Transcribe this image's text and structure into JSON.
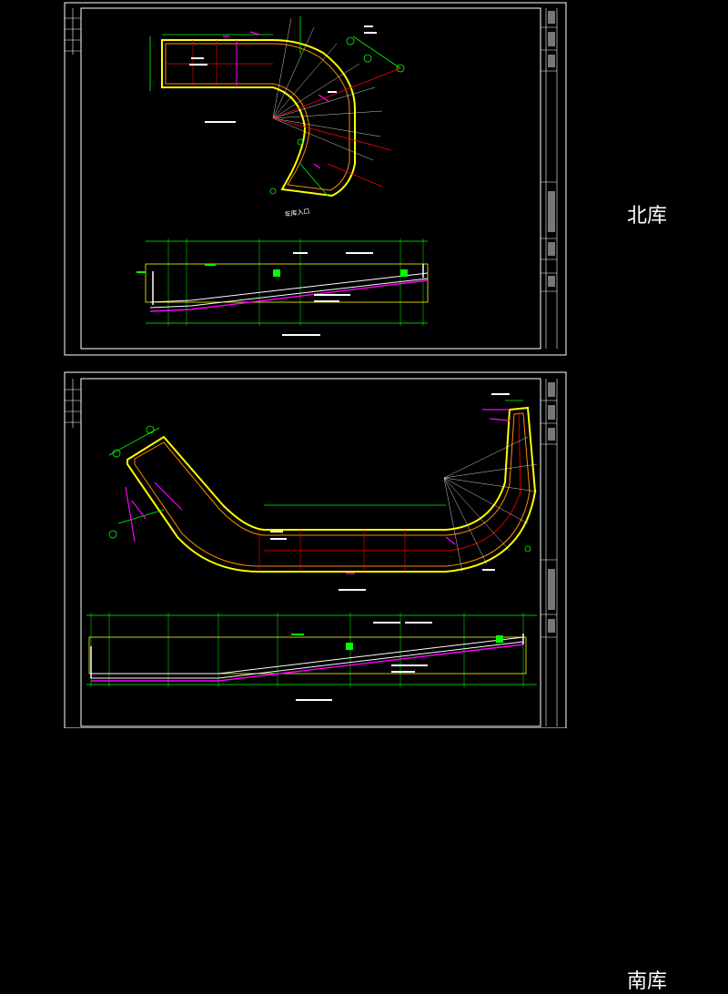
{
  "sheets": [
    {
      "id": "north",
      "label": "北库",
      "entrance_label": "车库入口"
    },
    {
      "id": "south",
      "label": "南库"
    }
  ],
  "colors": {
    "background": "#000000",
    "frame": "#ffffff",
    "wall_outline": "#ffff00",
    "wall_inner": "#ff8800",
    "dimension": "#00ff00",
    "accent": "#ff00ff",
    "axis": "#ff0000",
    "annotation": "#ffffff"
  }
}
